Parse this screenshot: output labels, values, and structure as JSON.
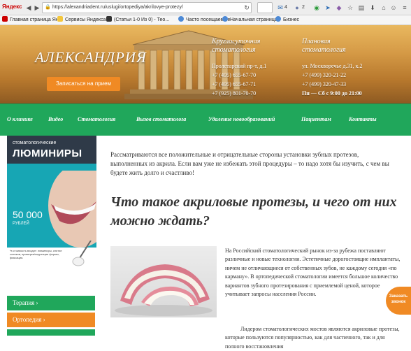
{
  "browser": {
    "yandex_label": "Яндекс",
    "url": "https://alexandriadent.ru/uslugi/ortopediya/akrilovye-protezy/",
    "mail_count": "4",
    "notif_count": "2",
    "bookmarks": [
      "Главная страница Ян...",
      "Сервисы Яндекса",
      "(Статьи 1-0 Из 0) - Тео...",
      "Часто посещаемые",
      "Начальная страница",
      "Бизнес"
    ]
  },
  "header": {
    "logo": "АЛЕКСАНДРИЯ",
    "appointment_button": "Записаться на прием",
    "col1": {
      "title_line1": "Круглосуточная",
      "title_line2": "стоматология",
      "address": "Пролетарский пр-т, д.1",
      "phone1": "+7 (495) 655-67-70",
      "phone2": "+7 (495) 655-67-71",
      "phone3": "+7 (925) 801-70-70"
    },
    "col2": {
      "title_line1": "Плановая",
      "title_line2": "стоматология",
      "address": "ул. Москворечье д.31, к.2",
      "phone1": "+7 (499) 320-21-22",
      "phone2": "+7 (499) 320-47-33",
      "hours": "Пн — Сб с 9:00 до 21:00"
    }
  },
  "nav": {
    "items": [
      "О клинике",
      "Видео",
      "Стоматология",
      "Вызов стоматолога",
      "Удаление новообразований",
      "Пациентам",
      "Контакты"
    ]
  },
  "sidebar": {
    "ad": {
      "line1": "стоматологические",
      "line2": "ЛЮМИНИРЫ",
      "price": "50 000",
      "currency": "РУБЛЕЙ",
      "footnote": "*в стоимость входит: люминиры, снятие слепков, примерка/коррекция формы, фиксация."
    },
    "menu": [
      {
        "label": "Терапия ›",
        "color": "#20a75b"
      },
      {
        "label": "Ортопедия ›",
        "color": "#f08a24"
      }
    ]
  },
  "content": {
    "intro": "Рассматриваются все положительные и отрицательные стороны установки зубных протезов, выполненных из акрила. Если вам уже не избежать этой процедуры – то надо хотя бы изучить, с чем вы будете жить долго и счастливо!",
    "heading": "Что такое акриловые протезы, и чего от них можно ждать?",
    "para1": "На Российский стоматологический рынок из-за рубежа поставляют различные и новые технологии. Эстетичные дорогостоящие имплантаты, ничем не отличающиеся от собственных зубов, не каждому сегодня «по карману». В ортопедической стоматологии имеется большое количество вариантов зубного протезирования с приемлемой ценой, которое учитывает запросы населения России.",
    "para2": "Лидером стоматологических мостов являются акриловые протезы, которые пользуются популярностью, как для частичного, так и для полного восстановления"
  },
  "callback": {
    "line1": "Заказать",
    "line2": "звонок"
  }
}
